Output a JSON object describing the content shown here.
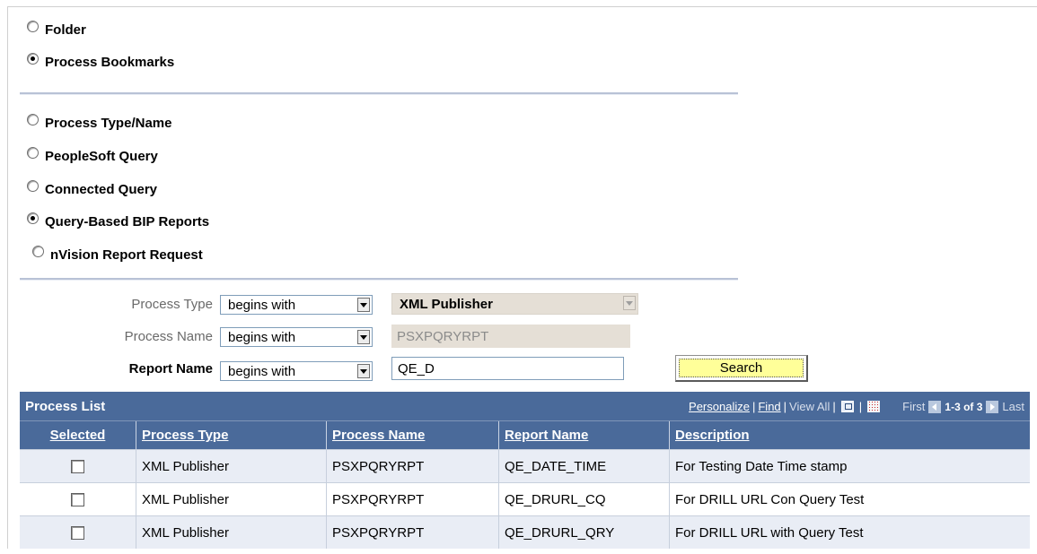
{
  "select_type": {
    "options": [
      {
        "label": "Folder",
        "checked": false
      },
      {
        "label": "Process Bookmarks",
        "checked": true
      }
    ]
  },
  "bookmark_type": {
    "options": [
      {
        "label": "Process Type/Name",
        "checked": false
      },
      {
        "label": "PeopleSoft Query",
        "checked": false
      },
      {
        "label": "Connected Query",
        "checked": false
      },
      {
        "label": "Query-Based BIP Reports",
        "checked": true
      },
      {
        "label": "nVision Report Request",
        "checked": false
      }
    ]
  },
  "criteria": {
    "process_type": {
      "label": "Process Type",
      "operator": "begins with",
      "value": "XML Publisher"
    },
    "process_name": {
      "label": "Process Name",
      "operator": "begins with",
      "value": "PSXPQRYRPT"
    },
    "report_name": {
      "label": "Report Name",
      "operator": "begins with",
      "value": "QE_D"
    },
    "search_label": "Search"
  },
  "process_list": {
    "title": "Process List",
    "nav": {
      "personalize": "Personalize",
      "find": "Find",
      "view_all": "View All",
      "first": "First",
      "range": "1-3 of 3",
      "last": "Last"
    },
    "columns": [
      "Selected",
      "Process Type",
      "Process Name",
      "Report Name",
      "Description"
    ],
    "rows": [
      {
        "selected": false,
        "process_type": "XML Publisher",
        "process_name": "PSXPQRYRPT",
        "report_name": "QE_DATE_TIME",
        "description": "For Testing Date Time stamp"
      },
      {
        "selected": false,
        "process_type": "XML Publisher",
        "process_name": "PSXPQRYRPT",
        "report_name": "QE_DRURL_CQ",
        "description": "For DRILL URL Con Query Test"
      },
      {
        "selected": false,
        "process_type": "XML Publisher",
        "process_name": "PSXPQRYRPT",
        "report_name": "QE_DRURL_QRY",
        "description": "For DRILL URL with Query Test"
      }
    ]
  },
  "colors": {
    "grid_header": "#4a6a9a",
    "row_alt": "#e9edf5",
    "search_button": "#ffff99",
    "disabled_field": "#e5dfd6"
  }
}
